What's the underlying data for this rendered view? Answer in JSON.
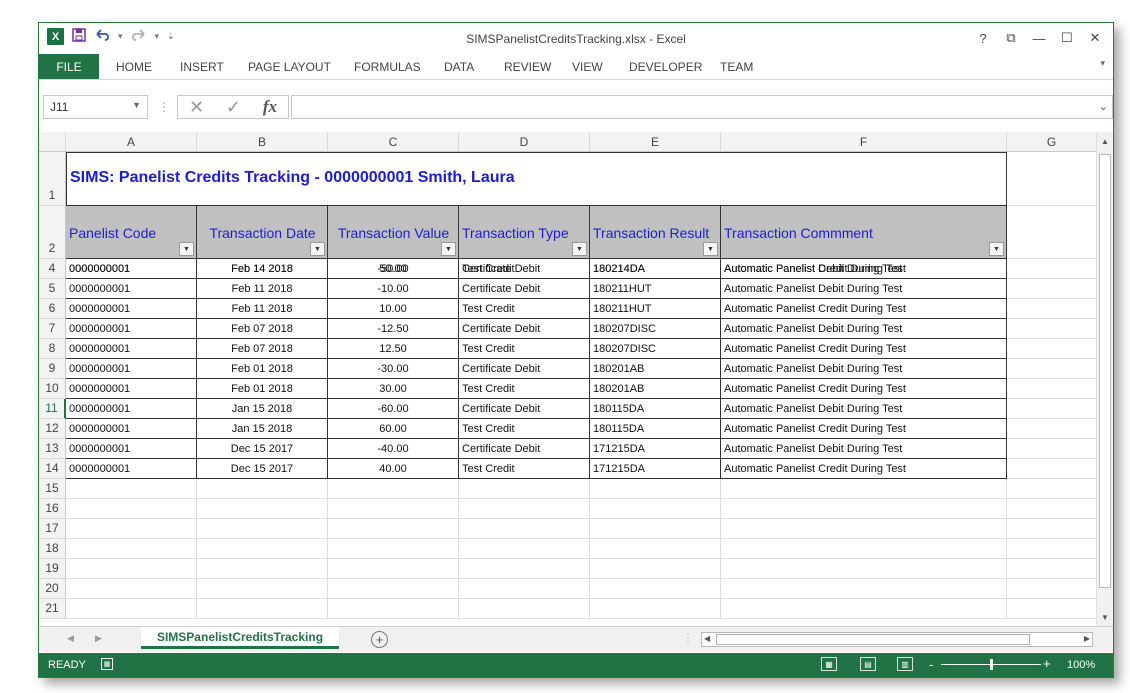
{
  "window": {
    "title": "SIMSPanelistCreditsTracking.xlsx - Excel",
    "controls": {
      "help": "?",
      "ribbon_display": "⧉",
      "minimize": "—",
      "maximize": "☐",
      "close": "✕"
    }
  },
  "qat": {
    "logo": "X",
    "save_icon": "save-icon",
    "undo_icon": "undo-icon",
    "redo_icon": "redo-icon",
    "customize_icon": "customize-icon"
  },
  "ribbon": {
    "file": "FILE",
    "tabs": [
      "HOME",
      "INSERT",
      "PAGE LAYOUT",
      "FORMULAS",
      "DATA",
      "REVIEW",
      "VIEW",
      "DEVELOPER",
      "TEAM"
    ]
  },
  "formula_bar": {
    "name_box": "J11",
    "fx": "fx",
    "cancel": "✕",
    "enter": "✓",
    "value": ""
  },
  "columns": [
    "A",
    "B",
    "C",
    "D",
    "E",
    "F",
    "G"
  ],
  "rows": [
    "1",
    "2",
    "3",
    "4",
    "5",
    "6",
    "7",
    "8",
    "9",
    "10",
    "11",
    "12",
    "13",
    "14",
    "15",
    "16",
    "17",
    "18",
    "19",
    "20",
    "21"
  ],
  "active_row": "11",
  "sheet": {
    "title": "SIMS: Panelist Credits Tracking - 0000000001  Smith, Laura",
    "headers": [
      "Panelist Code",
      "Transaction Date",
      "Transaction Value",
      "Transaction Type",
      "Transaction Result",
      "Transaction Commment"
    ],
    "data": [
      [
        "0000000001",
        "Feb 14 2018",
        "-50.00",
        "Certificate Debit",
        "180214DA",
        "Automatic Panelist Debit During Test"
      ],
      [
        "0000000001",
        "Feb 14 2018",
        "50.00",
        "Test Credit",
        "180214DA",
        "Automatic Panelist Credit During Test"
      ],
      [
        "0000000001",
        "Feb 11 2018",
        "-10.00",
        "Certificate Debit",
        "180211HUT",
        "Automatic Panelist Debit During Test"
      ],
      [
        "0000000001",
        "Feb 11 2018",
        "10.00",
        "Test Credit",
        "180211HUT",
        "Automatic Panelist Credit During Test"
      ],
      [
        "0000000001",
        "Feb 07 2018",
        "-12.50",
        "Certificate Debit",
        "180207DISC",
        "Automatic Panelist Debit During Test"
      ],
      [
        "0000000001",
        "Feb 07 2018",
        "12.50",
        "Test Credit",
        "180207DISC",
        "Automatic Panelist Credit During Test"
      ],
      [
        "0000000001",
        "Feb 01 2018",
        "-30.00",
        "Certificate Debit",
        "180201AB",
        "Automatic Panelist Debit During Test"
      ],
      [
        "0000000001",
        "Feb 01 2018",
        "30.00",
        "Test Credit",
        "180201AB",
        "Automatic Panelist Credit During Test"
      ],
      [
        "0000000001",
        "Jan 15 2018",
        "-60.00",
        "Certificate Debit",
        "180115DA",
        "Automatic Panelist Debit During Test"
      ],
      [
        "0000000001",
        "Jan 15 2018",
        "60.00",
        "Test Credit",
        "180115DA",
        "Automatic Panelist Credit During Test"
      ],
      [
        "0000000001",
        "Dec 15 2017",
        "-40.00",
        "Certificate Debit",
        "171215DA",
        "Automatic Panelist Debit During Test"
      ],
      [
        "0000000001",
        "Dec 15 2017",
        "40.00",
        "Test Credit",
        "171215DA",
        "Automatic Panelist Credit During Test"
      ]
    ]
  },
  "sheet_tabs": {
    "active": "SIMSPanelistCreditsTracking",
    "add": "+"
  },
  "status": {
    "ready": "READY",
    "zoom": "100%",
    "zoom_minus": "-",
    "zoom_plus": "+",
    "zoom_level": 0.5
  },
  "colors": {
    "accent": "#217346",
    "title_text": "#1c1cd6",
    "header_fill": "#c0c0c0"
  }
}
